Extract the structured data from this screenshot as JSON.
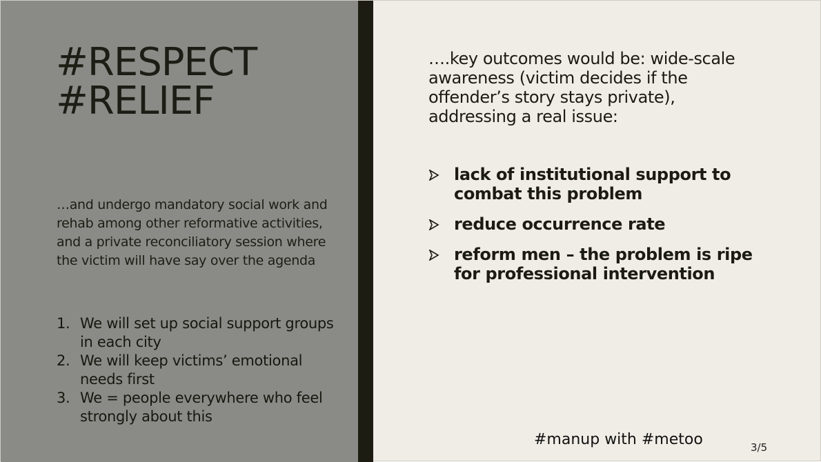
{
  "slide": {
    "title_lines": [
      "#RESPECT",
      "#RELIEF"
    ],
    "intro": "…and undergo mandatory social work and rehab among other reformative activities, and a private reconciliatory session where the victim will have say over the agenda",
    "steps": [
      {
        "number": "1.",
        "text": "We will set up social support groups in each city"
      },
      {
        "number": "2.",
        "text": "We will keep victims’ emotional needs first"
      },
      {
        "number": "3.",
        "text": "We = people everywhere who feel strongly about this"
      }
    ],
    "lead": "….key outcomes would be: wide-scale awareness (victim decides if the offender’s story stays private), addressing a real issue:",
    "bullets": [
      {
        "icon": "arrow-bullet-icon",
        "text": "lack of institutional support to combat this problem"
      },
      {
        "icon": "arrow-bullet-icon",
        "text": "reduce occurrence rate"
      },
      {
        "icon": "arrow-bullet-icon",
        "text": "reform men – the problem is ripe for professional intervention"
      }
    ],
    "footer_hashtags": "#manup with #metoo",
    "page_number": "3/5"
  },
  "colors": {
    "left_panel": "#8a8b86",
    "divider_bar": "#1c1c12",
    "right_panel": "#f0ede6",
    "text": "#1b1b14"
  }
}
